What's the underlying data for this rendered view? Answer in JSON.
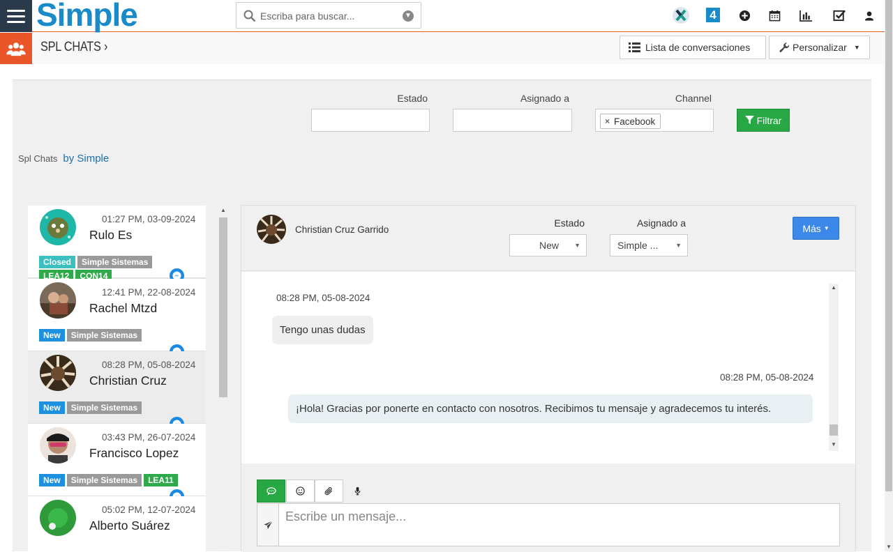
{
  "topbar": {
    "logo_text": "Simple",
    "search_placeholder": "Escriba para buscar...",
    "icons": [
      "x-app-icon",
      "badge-4-icon",
      "plus-circle-icon",
      "calendar-icon",
      "bar-chart-icon",
      "checkbox-icon",
      "user-icon"
    ],
    "badge_number": "4"
  },
  "subbar": {
    "breadcrumb": "SPL CHATS",
    "list_button": "Lista de conversaciones",
    "customize_button": "Personalizar"
  },
  "filters": {
    "estado_label": "Estado",
    "asignado_label": "Asignado a",
    "channel_label": "Channel",
    "channel_chip": "Facebook",
    "filter_button": "Filtrar",
    "credit_app": "Spl Chats",
    "credit_by": "by Simple"
  },
  "chats": [
    {
      "time": "01:27 PM, 03-09-2024",
      "name": "Rulo Es",
      "tags": [
        {
          "text": "Closed",
          "kind": "closed"
        },
        {
          "text": "Simple Sistemas",
          "kind": "simple"
        },
        {
          "text": "LEA12",
          "kind": "green"
        },
        {
          "text": "CON14",
          "kind": "green"
        }
      ]
    },
    {
      "time": "12:41 PM, 22-08-2024",
      "name": "Rachel Mtzd",
      "tags": [
        {
          "text": "New",
          "kind": "new"
        },
        {
          "text": "Simple Sistemas",
          "kind": "simple"
        }
      ]
    },
    {
      "time": "08:28 PM, 05-08-2024",
      "name": "Christian Cruz",
      "tags": [
        {
          "text": "New",
          "kind": "new"
        },
        {
          "text": "Simple Sistemas",
          "kind": "simple"
        }
      ],
      "selected": true
    },
    {
      "time": "03:43 PM, 26-07-2024",
      "name": "Francisco Lopez",
      "tags": [
        {
          "text": "New",
          "kind": "new"
        },
        {
          "text": "Simple Sistemas",
          "kind": "simple"
        },
        {
          "text": "LEA11",
          "kind": "green"
        }
      ]
    },
    {
      "time": "05:02 PM, 12-07-2024",
      "name": "Alberto Suárez",
      "tags": []
    }
  ],
  "conversation": {
    "contact_name": "Christian Cruz Garrido",
    "estado_label": "Estado",
    "estado_value": "New",
    "asignado_label": "Asignado a",
    "asignado_value": "Simple ...",
    "more_button": "Más",
    "messages": [
      {
        "time": "08:28 PM, 05-08-2024",
        "text": "Tengo unas dudas",
        "direction": "in"
      },
      {
        "time": "08:28 PM, 05-08-2024",
        "text": "¡Hola! Gracias por ponerte en contacto con nosotros. Recibimos tu mensaje y agradecemos tu interés.",
        "direction": "out"
      }
    ],
    "composer_placeholder": "Escribe un mensaje..."
  },
  "colors": {
    "accent_orange": "#e8562a",
    "brand_blue": "#1a8ac8",
    "green": "#27a844",
    "blue_button": "#3b88e8"
  }
}
